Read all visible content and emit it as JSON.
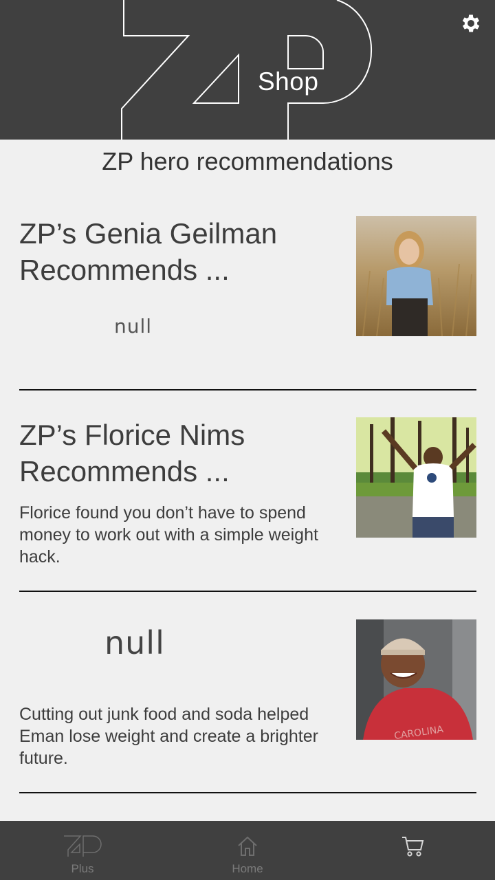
{
  "header": {
    "shop_label": "Shop"
  },
  "section_title": "ZP hero recommendations",
  "cards": [
    {
      "title": "ZP’s Genia Geilman Recommends ...",
      "subtitle_null": "null",
      "description": ""
    },
    {
      "title": "ZP’s Florice Nims Recommends ...",
      "description": "Florice found you don’t have to spend money to work out with a simple weight hack."
    },
    {
      "title_null": "null",
      "description": "Cutting out junk food and soda helped Eman lose weight and create a brighter future."
    }
  ],
  "bottom_nav": {
    "items": [
      {
        "label": "Plus",
        "icon": "zp-logo-icon"
      },
      {
        "label": "Home",
        "icon": "home-icon"
      },
      {
        "label": "",
        "icon": "cart-icon"
      }
    ]
  },
  "colors": {
    "header_bg": "#404040",
    "page_bg": "#f0f0f0",
    "text": "#3d3d3d"
  }
}
